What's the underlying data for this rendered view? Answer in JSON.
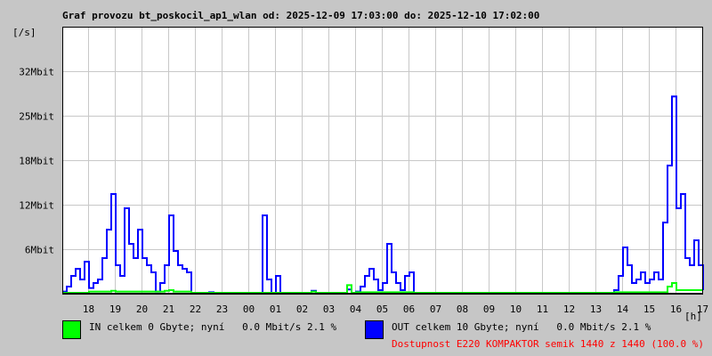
{
  "title": "Graf provozu bt_poskocil_ap1_wlan od: 2025-12-09 17:03:00 do: 2025-12-10 17:02:00",
  "y_unit": "[/s]",
  "x_unit": "[h]",
  "legend": {
    "in": {
      "label": "IN celkem 0 Gbyte; nyní   0.0 Mbit/s 2.1 %",
      "color": "#00ff00"
    },
    "out": {
      "label": "OUT celkem 10 Gbyte; nyní   0.0 Mbit/s 2.1 %",
      "color": "#0000ff"
    },
    "availability": "Dostupnost E220 KOMPAKTOR semik 1440 z 1440 (100.0 %)",
    "availability_color": "#ff0000"
  },
  "chart_data": {
    "type": "line",
    "title": "Graf provozu bt_poskocil_ap1_wlan od: 2025-12-09 17:03:00 do: 2025-12-10 17:02:00",
    "xlabel": "[h]",
    "ylabel": "[/s]",
    "x_start": "2025-12-09 17:03",
    "x_step_minutes": 10,
    "x_range_minutes": [
      0,
      1440
    ],
    "ylim_mbit": [
      0,
      37.5
    ],
    "grid": true,
    "x_ticks": [
      {
        "label": "18",
        "minute": 57
      },
      {
        "label": "19",
        "minute": 117
      },
      {
        "label": "20",
        "minute": 177
      },
      {
        "label": "21",
        "minute": 237
      },
      {
        "label": "22",
        "minute": 297
      },
      {
        "label": "23",
        "minute": 357
      },
      {
        "label": "00",
        "minute": 417
      },
      {
        "label": "01",
        "minute": 477
      },
      {
        "label": "02",
        "minute": 537
      },
      {
        "label": "03",
        "minute": 597
      },
      {
        "label": "04",
        "minute": 657
      },
      {
        "label": "05",
        "minute": 717
      },
      {
        "label": "06",
        "minute": 777
      },
      {
        "label": "07",
        "minute": 837
      },
      {
        "label": "08",
        "minute": 897
      },
      {
        "label": "09",
        "minute": 957
      },
      {
        "label": "10",
        "minute": 1017
      },
      {
        "label": "11",
        "minute": 1077
      },
      {
        "label": "12",
        "minute": 1137
      },
      {
        "label": "13",
        "minute": 1197
      },
      {
        "label": "14",
        "minute": 1257
      },
      {
        "label": "15",
        "minute": 1317
      },
      {
        "label": "16",
        "minute": 1377
      },
      {
        "label": "17",
        "minute": 1437
      }
    ],
    "y_ticks": [
      {
        "label": "6Mbit",
        "value": 6.25
      },
      {
        "label": "12Mbit",
        "value": 12.5
      },
      {
        "label": "18Mbit",
        "value": 18.75
      },
      {
        "label": "25Mbit",
        "value": 25
      },
      {
        "label": "32Mbit",
        "value": 31.25
      }
    ],
    "legend_position": "bottom",
    "series": [
      {
        "name": "OUT",
        "color": "#0000ff",
        "values": [
          0.3,
          1.0,
          2.5,
          3.5,
          2.0,
          4.5,
          0.8,
          1.5,
          2.0,
          5.0,
          9.0,
          14.0,
          4.0,
          2.5,
          12.0,
          7.0,
          5.0,
          9.0,
          5.0,
          4.0,
          3.0,
          0.3,
          1.5,
          4.0,
          11.0,
          6.0,
          4.0,
          3.5,
          3.0,
          0.1,
          0,
          0,
          0,
          0.2,
          0,
          0,
          0,
          0,
          0,
          0,
          0,
          0,
          0,
          0,
          0,
          11.0,
          2.0,
          0.1,
          2.5,
          0,
          0,
          0,
          0,
          0,
          0,
          0,
          0.4,
          0,
          0,
          0,
          0,
          0,
          0,
          0,
          0.6,
          0,
          0.3,
          1.0,
          2.5,
          3.5,
          2.0,
          0.5,
          1.5,
          7.0,
          3.0,
          1.5,
          0.5,
          2.5,
          3.0,
          0,
          0,
          0,
          0,
          0,
          0,
          0,
          0,
          0,
          0,
          0,
          0,
          0,
          0,
          0,
          0,
          0,
          0,
          0,
          0,
          0,
          0,
          0,
          0,
          0,
          0,
          0,
          0,
          0,
          0,
          0,
          0,
          0,
          0,
          0,
          0,
          0,
          0,
          0,
          0,
          0,
          0,
          0,
          0,
          0,
          0.5,
          2.5,
          6.5,
          4.0,
          1.5,
          2.0,
          3.0,
          1.5,
          2.0,
          3.0,
          2.0,
          10.0,
          18.0,
          27.7,
          12.0,
          14.0,
          5.0,
          4.0,
          7.5,
          4.0,
          0.5
        ]
      },
      {
        "name": "IN",
        "color": "#00ff00",
        "values": [
          0.1,
          0.1,
          0.1,
          0.1,
          0.1,
          0.1,
          0.3,
          0.3,
          0.3,
          0.3,
          0.3,
          0.4,
          0.3,
          0.3,
          0.3,
          0.3,
          0.3,
          0.3,
          0.3,
          0.3,
          0.3,
          0.3,
          0.3,
          0.4,
          0.5,
          0.3,
          0.3,
          0.3,
          0.3,
          0,
          0,
          0,
          0,
          0,
          0,
          0,
          0,
          0,
          0,
          0,
          0,
          0,
          0,
          0,
          0,
          0,
          0,
          0,
          0,
          0,
          0,
          0,
          0,
          0,
          0,
          0,
          0.3,
          0,
          0,
          0,
          0,
          0,
          0,
          0,
          1.2,
          0,
          0.2,
          0.2,
          0.2,
          0.2,
          0.2,
          0.2,
          0.2,
          0.2,
          0.2,
          0.2,
          0.2,
          0.2,
          0.2,
          0,
          0,
          0,
          0,
          0,
          0,
          0,
          0,
          0,
          0,
          0,
          0,
          0,
          0,
          0,
          0,
          0,
          0,
          0,
          0,
          0,
          0,
          0,
          0,
          0,
          0,
          0,
          0,
          0,
          0,
          0,
          0,
          0,
          0,
          0,
          0,
          0,
          0,
          0,
          0,
          0,
          0,
          0,
          0,
          0,
          0.2,
          0.2,
          0.2,
          0.2,
          0.2,
          0.2,
          0.2,
          0.2,
          0.2,
          0.2,
          0.2,
          0.2,
          1.0,
          1.5,
          0.5,
          0.5,
          0.5,
          0.5,
          0.5,
          0.5,
          0.5
        ]
      }
    ]
  }
}
